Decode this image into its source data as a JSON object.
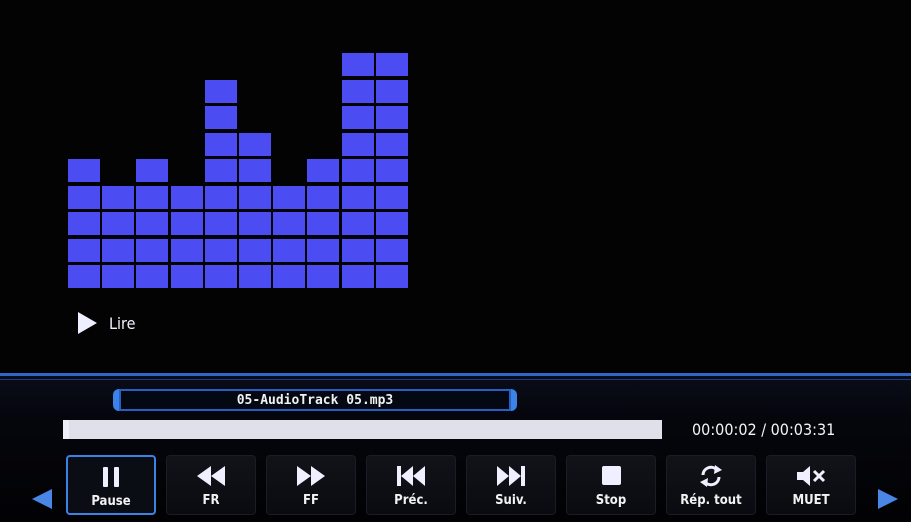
{
  "status": {
    "state_label": "Lire"
  },
  "visualizer": {
    "color": "#4b4cf2",
    "levels": [
      5,
      4,
      5,
      4,
      8,
      6,
      4,
      5,
      9,
      9
    ]
  },
  "track": {
    "filename": "05-AudioTrack 05.mp3"
  },
  "playback": {
    "elapsed": "00:00:02",
    "total": "00:03:31",
    "time_text": "00:00:02 / 00:03:31",
    "progress_fraction": 0.01
  },
  "controls": [
    {
      "key": "pause",
      "label": "Pause",
      "icon": "pause-icon",
      "active": true
    },
    {
      "key": "fr",
      "label": "FR",
      "icon": "rewind-icon",
      "active": false
    },
    {
      "key": "ff",
      "label": "FF",
      "icon": "fast-forward-icon",
      "active": false
    },
    {
      "key": "prev",
      "label": "Préc.",
      "icon": "skip-previous-icon",
      "active": false
    },
    {
      "key": "next",
      "label": "Suiv.",
      "icon": "skip-next-icon",
      "active": false
    },
    {
      "key": "stop",
      "label": "Stop",
      "icon": "stop-icon",
      "active": false
    },
    {
      "key": "repeat",
      "label": "Rép. tout",
      "icon": "repeat-icon",
      "active": false
    },
    {
      "key": "mute",
      "label": "MUET",
      "icon": "mute-icon",
      "active": false
    }
  ],
  "colors": {
    "accent": "#3a82e6",
    "progress_track": "#dfe0ea"
  }
}
